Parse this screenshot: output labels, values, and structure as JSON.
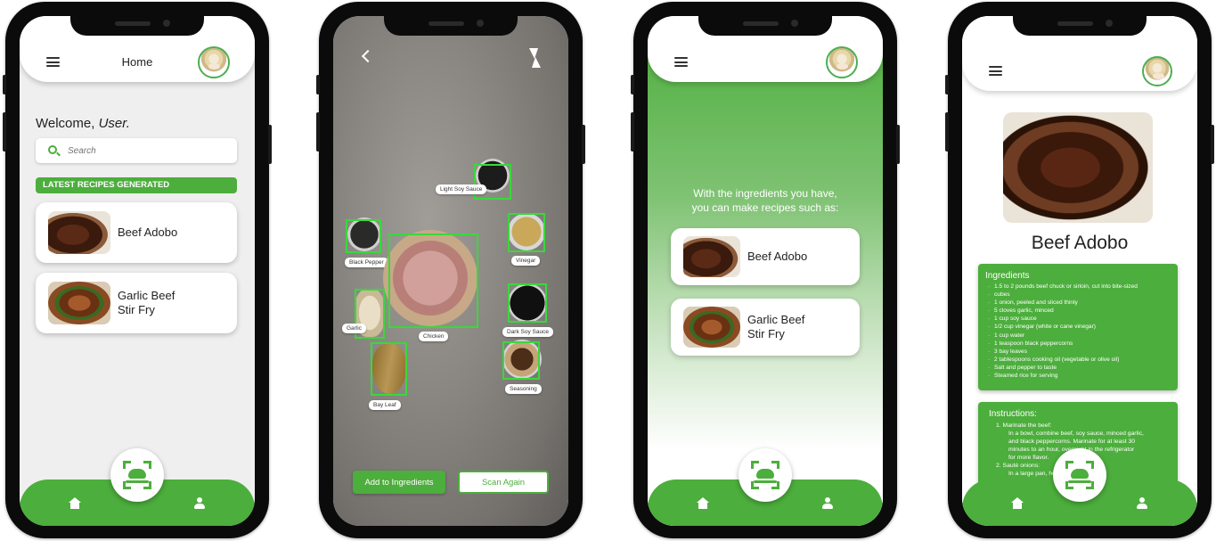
{
  "screen1": {
    "header_title": "Home",
    "welcome_prefix": "Welcome, ",
    "welcome_user": "User.",
    "search_placeholder": "Search",
    "section_title": "LATEST RECIPES GENERATED",
    "recipes": [
      {
        "name": "Beef Adobo",
        "thumb": "beef-adobo"
      },
      {
        "name": "Garlic Beef Stir Fry",
        "line1": "Garlic Beef",
        "line2": "Stir Fry",
        "thumb": "garlic-beef-stir-fry"
      }
    ]
  },
  "screen2": {
    "detections": [
      {
        "label": "Light Soy Sauce"
      },
      {
        "label": "Black Pepper"
      },
      {
        "label": "Vinegar"
      },
      {
        "label": "Garlic"
      },
      {
        "label": "Chicken"
      },
      {
        "label": "Dark Soy Sauce"
      },
      {
        "label": "Seasoning"
      },
      {
        "label": "Bay Leaf"
      }
    ],
    "add_button": "Add to Ingredients",
    "scan_again_button": "Scan Again"
  },
  "screen3": {
    "message_line1": "With the ingredients you have,",
    "message_line2": "you can make recipes such as:",
    "recipes": [
      {
        "name": "Beef Adobo"
      },
      {
        "line1": "Garlic Beef",
        "line2": "Stir Fry"
      }
    ]
  },
  "screen4": {
    "title": "Beef Adobo",
    "ingredients_heading": "Ingredients",
    "ingredients": [
      "1.5 to 2 pounds beef chuck or sirloin, cut into bite-sized",
      "cubes",
      "1 onion, peeled and sliced thinly",
      "5 cloves garlic, minced",
      "1 cup soy sauce",
      "1/2 cup vinegar (white or cane vinegar)",
      "1 cup water",
      "1 teaspoon black peppercorns",
      "3 bay leaves",
      "2 tablespoons cooking oil (vegetable or olive oil)",
      "Salt and pepper to taste",
      "Steamed rice for serving"
    ],
    "instructions_heading": "Instructions:",
    "step1": "1. Marinate the beef:",
    "step1_detail": [
      "In a bowl, combine beef, soy sauce, minced garlic,",
      "and black peppercorns. Marinate for at least 30",
      "minutes to an hour, overnight in the refrigerator",
      "for more flavor."
    ],
    "step2": "2. Sauté onions:",
    "step2_detail": "In a large pan, heat cooking oil over"
  },
  "colors": {
    "accent": "#4cae3c",
    "detect_box": "#3ad83a",
    "bg_light": "#efefef"
  },
  "icons": [
    "hamburger-icon",
    "avatar",
    "search-icon",
    "home-icon",
    "user-icon",
    "scan-icon",
    "back-icon",
    "flash-icon"
  ]
}
